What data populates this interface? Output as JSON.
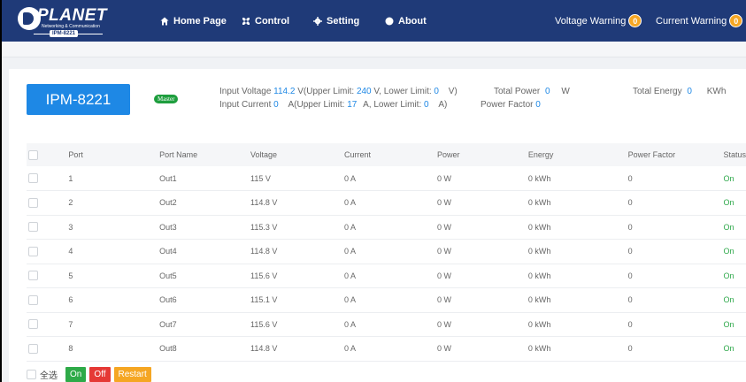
{
  "header": {
    "logo_text": "PLANET",
    "logo_subtitle": "Networking & Communication",
    "logo_model": "IPM-8221",
    "nav": [
      {
        "label": "Home Page",
        "icon": "home-icon"
      },
      {
        "label": "Control",
        "icon": "tools-icon"
      },
      {
        "label": "Setting",
        "icon": "gear-icon"
      },
      {
        "label": "About",
        "icon": "info-circle-icon"
      }
    ],
    "voltage_warning": {
      "label": "Voltage Warning",
      "count": "0"
    },
    "current_warning": {
      "label": "Current Warning",
      "count": "0"
    }
  },
  "device": {
    "name": "IPM-8221",
    "role": "Master",
    "input_voltage": {
      "label": "Input Voltage",
      "value": "114.2",
      "unit_upper": "V(Upper Limit:",
      "upper": "240",
      "unit_lower": "V,  Lower Limit:",
      "lower": "0",
      "end": "V)"
    },
    "input_current": {
      "label": "Input Current",
      "value": "0",
      "unit_upper": "A(Upper Limit:",
      "upper": "17",
      "unit_lower": "A,  Lower Limit:",
      "lower": "0",
      "end": "A)"
    },
    "total_power": {
      "label": "Total Power",
      "value": "0",
      "unit": "W"
    },
    "power_factor": {
      "label": "Power Factor",
      "value": "0"
    },
    "total_energy": {
      "label": "Total Energy",
      "value": "0",
      "unit": "KWh"
    }
  },
  "table": {
    "headers": [
      "Port",
      "Port Name",
      "Voltage",
      "Current",
      "Power",
      "Energy",
      "Power Factor",
      "Status"
    ],
    "rows": [
      {
        "port": "1",
        "name": "Out1",
        "voltage": "115 V",
        "current": "0 A",
        "power": "0 W",
        "energy": "0 kWh",
        "pf": "0",
        "status": "On"
      },
      {
        "port": "2",
        "name": "Out2",
        "voltage": "114.8 V",
        "current": "0 A",
        "power": "0 W",
        "energy": "0 kWh",
        "pf": "0",
        "status": "On"
      },
      {
        "port": "3",
        "name": "Out3",
        "voltage": "115.3 V",
        "current": "0 A",
        "power": "0 W",
        "energy": "0 kWh",
        "pf": "0",
        "status": "On"
      },
      {
        "port": "4",
        "name": "Out4",
        "voltage": "114.8 V",
        "current": "0 A",
        "power": "0 W",
        "energy": "0 kWh",
        "pf": "0",
        "status": "On"
      },
      {
        "port": "5",
        "name": "Out5",
        "voltage": "115.6 V",
        "current": "0 A",
        "power": "0 W",
        "energy": "0 kWh",
        "pf": "0",
        "status": "On"
      },
      {
        "port": "6",
        "name": "Out6",
        "voltage": "115.1 V",
        "current": "0 A",
        "power": "0 W",
        "energy": "0 kWh",
        "pf": "0",
        "status": "On"
      },
      {
        "port": "7",
        "name": "Out7",
        "voltage": "115.6 V",
        "current": "0 A",
        "power": "0 W",
        "energy": "0 kWh",
        "pf": "0",
        "status": "On"
      },
      {
        "port": "8",
        "name": "Out8",
        "voltage": "114.8 V",
        "current": "0 A",
        "power": "0 W",
        "energy": "0 kWh",
        "pf": "0",
        "status": "On"
      }
    ]
  },
  "actions": {
    "select_all": "全选",
    "on": "On",
    "off": "Off",
    "restart": "Restart"
  },
  "colors": {
    "header_bg": "#1f3a78",
    "accent": "#1e88e5",
    "status_on": "#2ea84a",
    "badge": "#f5a623",
    "off": "#e53935"
  }
}
